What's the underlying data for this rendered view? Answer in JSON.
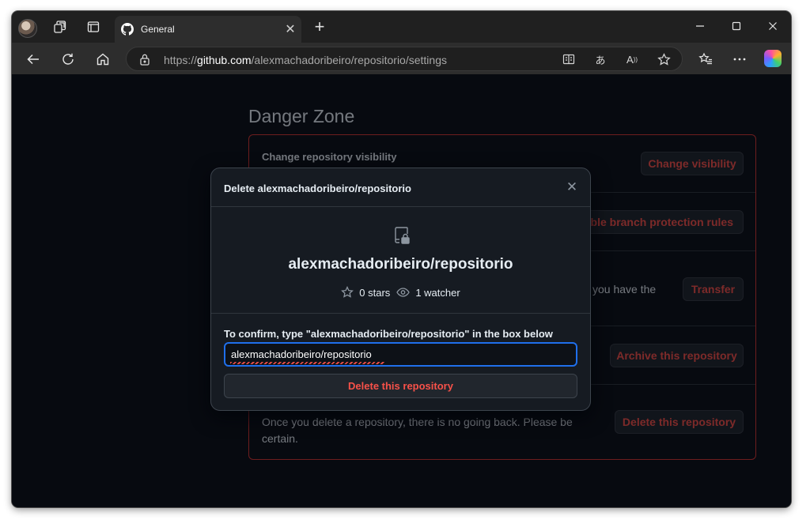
{
  "browser": {
    "tab": {
      "title": "General"
    },
    "address": {
      "scheme": "https://",
      "domain": "github.com",
      "path": "/alexmachadoribeiro/repositorio/settings"
    },
    "icons": [
      "profile-avatar",
      "workspaces-icon",
      "tab-actions-icon",
      "github-icon",
      "new-tab-icon",
      "minimize-icon",
      "maximize-icon",
      "close-icon",
      "back-icon",
      "refresh-icon",
      "home-icon",
      "lock-icon",
      "reading-view-icon",
      "translate-icon",
      "read-aloud-icon",
      "favorite-star-icon",
      "favorites-icon",
      "more-icon",
      "copilot-icon"
    ]
  },
  "danger_zone": {
    "title": "Danger Zone",
    "visibility": {
      "heading": "Change repository visibility",
      "button": "Change visibility"
    },
    "branch": {
      "button": "able branch protection rules"
    },
    "transfer": {
      "fragment": "you have the",
      "button": "Transfer"
    },
    "archive": {
      "button": "Archive this repository"
    },
    "delete": {
      "description": "Once you delete a repository, there is no going back. Please be certain.",
      "button": "Delete this repository"
    }
  },
  "dialog": {
    "title": "Delete alexmachadoribeiro/repositorio",
    "repo_name": "alexmachadoribeiro/repositorio",
    "stars": "0 stars",
    "watchers": "1 watcher",
    "confirm_label": "To confirm, type \"alexmachadoribeiro/repositorio\" in the box below",
    "input_value": "alexmachadoribeiro/repositorio",
    "delete_button": "Delete this repository"
  }
}
